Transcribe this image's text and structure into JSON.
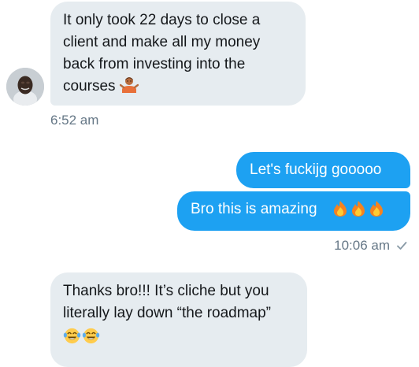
{
  "conversation": {
    "messages": [
      {
        "id": "m1",
        "direction": "incoming",
        "text": "It only took 22 days to close a client and make all my money back from investing into the courses",
        "emoji": [
          "person-shrugging-emoji"
        ]
      },
      {
        "id": "m2",
        "direction": "outgoing",
        "text": "Let's fuckijg gooooo"
      },
      {
        "id": "m3",
        "direction": "outgoing",
        "text": "Bro this is amazing",
        "emoji": [
          "fire-emoji",
          "fire-emoji",
          "fire-emoji"
        ]
      },
      {
        "id": "m4",
        "direction": "incoming",
        "text": "Thanks bro!!! It’s cliche but you literally lay down “the roadmap”",
        "emoji": [
          "tears-of-joy-emoji",
          "tears-of-joy-emoji"
        ]
      }
    ],
    "timestamps": {
      "incoming_1": "6:52 am",
      "outgoing_1": "10:06 am"
    },
    "read_receipt_icon": "checkmark-icon"
  },
  "colors": {
    "incoming_bubble": "#e6ecf0",
    "outgoing_bubble": "#1da1f2",
    "timestamp": "#657786",
    "text_dark": "#14171a"
  }
}
